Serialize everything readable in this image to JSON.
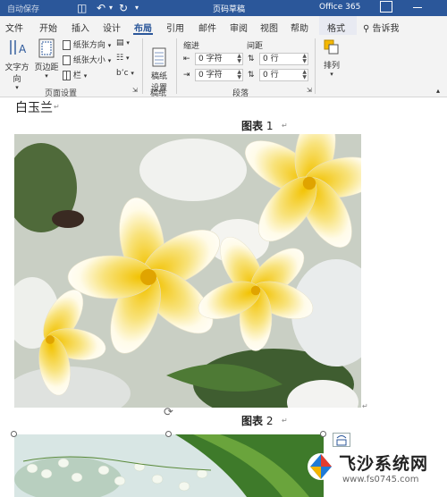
{
  "title_bar": {
    "autosave": "自动保存",
    "doc_title": "页码草稿",
    "app": "Office 365"
  },
  "tabs": [
    "文件",
    "开始",
    "插入",
    "设计",
    "布局",
    "引用",
    "邮件",
    "审阅",
    "视图",
    "帮助",
    "格式"
  ],
  "active_tab": "布局",
  "tell_me": "告诉我",
  "ribbon": {
    "text_direction": "文字方向",
    "margins": "页边距",
    "orientation": "纸张方向",
    "size": "纸张大小",
    "columns": "栏",
    "page_setup_group": "页面设置",
    "draft_paper": "稿纸\n设置",
    "draft_group": "稿纸",
    "indent_label": "缩进",
    "spacing_label": "间距",
    "indent_left": "0 字符",
    "indent_right": "0 字符",
    "spacing_before": "0 行",
    "spacing_after": "0 行",
    "paragraph_group": "段落",
    "arrange": "排列"
  },
  "document": {
    "heading": "白玉兰",
    "caption1_label": "图表",
    "caption1_num": "1",
    "caption2_label": "图表",
    "caption2_num": "2"
  },
  "watermark": {
    "brand": "飞沙系统网",
    "url": "www.fs0745.com"
  },
  "colors": {
    "title_bar": "#2b579a",
    "ribbon_bg": "#f3f3f3",
    "accent": "#2b579a"
  }
}
